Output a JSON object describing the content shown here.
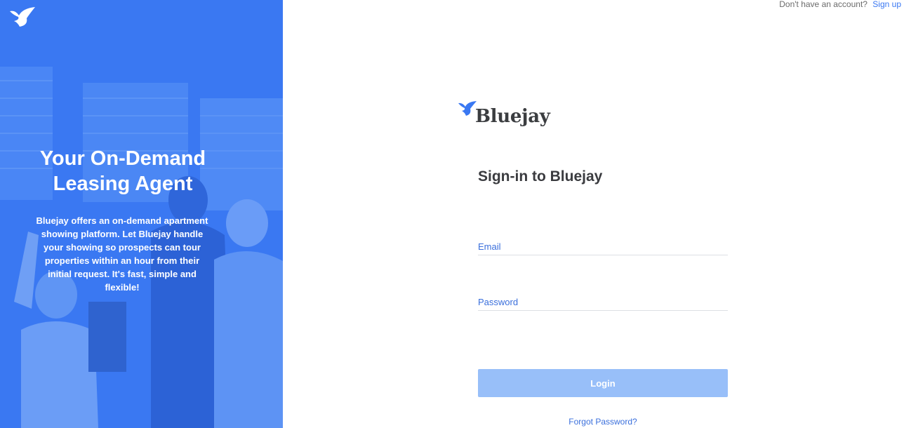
{
  "hero": {
    "title": "Your On-Demand Leasing Agent",
    "description": "Bluejay offers an on-demand apartment showing platform. Let Bluejay handle your showing so prospects can tour properties within an hour from their initial request. It's fast, simple and flexible!"
  },
  "topbar": {
    "prompt": "Don't have an account?",
    "signup_label": "Sign up"
  },
  "brand": {
    "name": "Bluejay",
    "icon": "bird-icon"
  },
  "form": {
    "title": "Sign-in to Bluejay",
    "email_placeholder": "Email",
    "password_placeholder": "Password",
    "login_label": "Login",
    "forgot_label": "Forgot Password?"
  },
  "colors": {
    "accent": "#3a78f2",
    "button_disabled": "#98bff9"
  }
}
